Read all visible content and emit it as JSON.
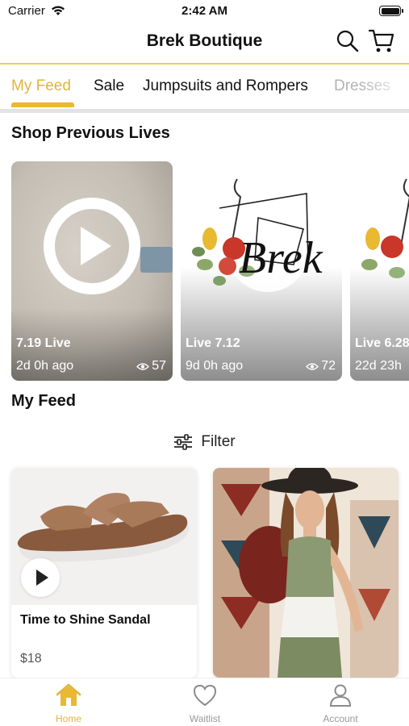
{
  "status_bar": {
    "carrier": "Carrier",
    "time": "2:42 AM"
  },
  "header": {
    "title": "Brek Boutique"
  },
  "tabs": [
    {
      "label": "My Feed",
      "active": true
    },
    {
      "label": "Sale"
    },
    {
      "label": "Jumpsuits and Rompers"
    },
    {
      "label": "Dresses"
    }
  ],
  "sections": {
    "previous_lives": "Shop Previous Lives",
    "my_feed": "My Feed"
  },
  "lives": [
    {
      "name": "7.19 Live",
      "ago": "2d 0h ago",
      "views": "57"
    },
    {
      "name": "Live 7.12",
      "ago": "9d 0h ago",
      "views": "72"
    },
    {
      "name": "Live 6.28",
      "ago": "22d 23h",
      "views": ""
    }
  ],
  "filter": {
    "label": "Filter"
  },
  "products": [
    {
      "name": "Time to Shine Sandal",
      "price": "$18"
    },
    {
      "name": "",
      "price": ""
    }
  ],
  "bottom_nav": [
    {
      "label": "Home",
      "active": true
    },
    {
      "label": "Waitlist"
    },
    {
      "label": "Account"
    }
  ],
  "colors": {
    "accent": "#e1b43a",
    "divider": "#e8cf56"
  }
}
